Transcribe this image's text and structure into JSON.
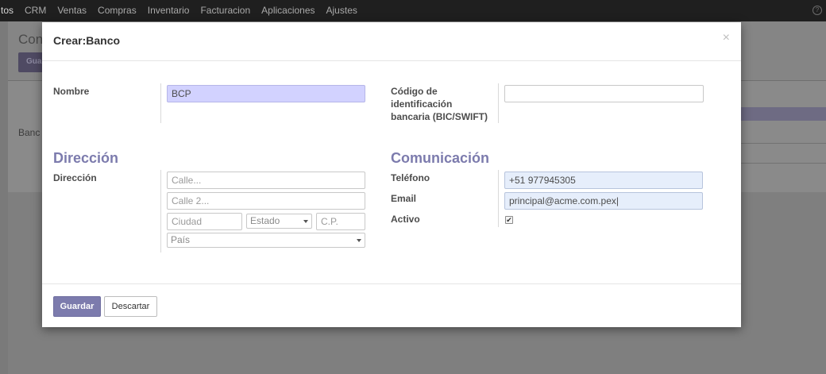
{
  "navbar": {
    "items": [
      "tos",
      "CRM",
      "Ventas",
      "Compras",
      "Inventario",
      "Facturacion",
      "Aplicaciones",
      "Ajustes"
    ]
  },
  "background": {
    "title": "Con",
    "button_label": "Gua",
    "field_label": "Banc"
  },
  "modal": {
    "title": "Crear:Banco",
    "close_glyph": "×",
    "left": {
      "name_label": "Nombre",
      "name_value": "BCP",
      "section_title": "Dirección",
      "address_label": "Dirección",
      "street_placeholder": "Calle...",
      "street2_placeholder": "Calle 2...",
      "city_placeholder": "Ciudad",
      "state_placeholder": "Estado",
      "zip_placeholder": "C.P.",
      "country_placeholder": "País"
    },
    "right": {
      "bic_label": "Código de identificación bancaria (BIC/SWIFT)",
      "bic_value": "",
      "section_title": "Comunicación",
      "phone_label": "Teléfono",
      "phone_value": "+51 977945305",
      "email_label": "Email",
      "email_value": "principal@acme.com.pex|",
      "active_label": "Activo",
      "active_checked": true,
      "active_glyph": "✔"
    },
    "footer": {
      "save_label": "Guardar",
      "discard_label": "Descartar"
    }
  },
  "colors": {
    "accent": "#7c7bad",
    "navbar": "#1f1f1f",
    "required_field": "#d2d2ff"
  }
}
